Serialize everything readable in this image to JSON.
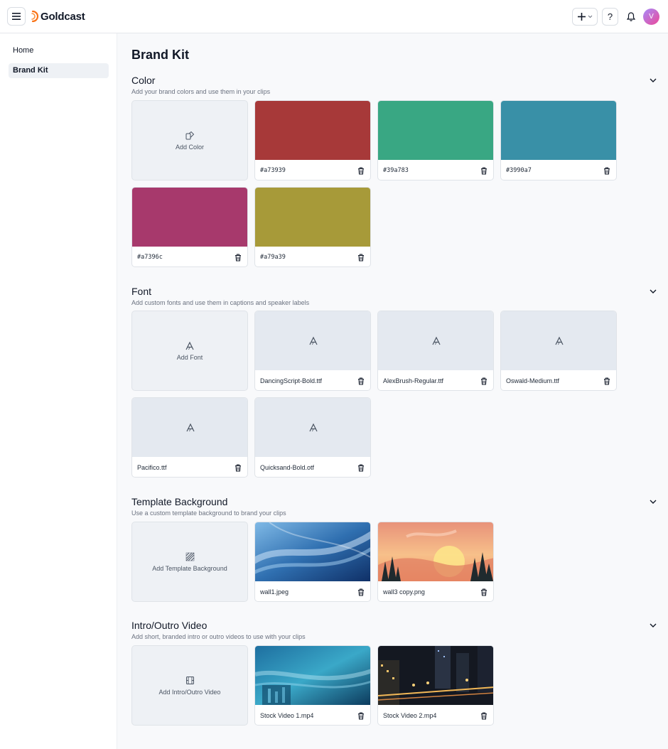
{
  "header": {
    "brand_name": "Goldcast",
    "help_label": "?",
    "avatar_initial": "V"
  },
  "sidebar": {
    "items": [
      {
        "label": "Home",
        "active": false
      },
      {
        "label": "Brand Kit",
        "active": true
      }
    ]
  },
  "page": {
    "title": "Brand Kit"
  },
  "sections": {
    "color": {
      "title": "Color",
      "subtitle": "Add your brand colors and use them in your clips",
      "add_label": "Add Color",
      "items": [
        {
          "name": "#a73939",
          "color": "#a73939"
        },
        {
          "name": "#39a783",
          "color": "#39a783"
        },
        {
          "name": "#3990a7",
          "color": "#3990a7"
        },
        {
          "name": "#a7396c",
          "color": "#a7396c"
        },
        {
          "name": "#a79a39",
          "color": "#a79a39"
        }
      ]
    },
    "font": {
      "title": "Font",
      "subtitle": "Add custom fonts and use them in captions and speaker labels",
      "add_label": "Add Font",
      "items": [
        {
          "name": "DancingScript-Bold.ttf"
        },
        {
          "name": "AlexBrush-Regular.ttf"
        },
        {
          "name": "Oswald-Medium.ttf"
        },
        {
          "name": "Pacifico.ttf"
        },
        {
          "name": "Quicksand-Bold.otf"
        }
      ]
    },
    "background": {
      "title": "Template Background",
      "subtitle": "Use a custom template background to brand your clips",
      "add_label": "Add Template Background",
      "items": [
        {
          "name": "wall1.jpeg"
        },
        {
          "name": "wall3 copy.png"
        }
      ]
    },
    "video": {
      "title": "Intro/Outro Video",
      "subtitle": "Add short, branded intro or outro videos to use with your clips",
      "add_label": "Add Intro/Outro Video",
      "items": [
        {
          "name": "Stock Video 1.mp4"
        },
        {
          "name": "Stock Video 2.mp4"
        }
      ]
    }
  },
  "colors": {
    "accent_logo": "#f97316",
    "card_add_bg": "#eef1f5",
    "page_bg": "#f8f9fb"
  }
}
